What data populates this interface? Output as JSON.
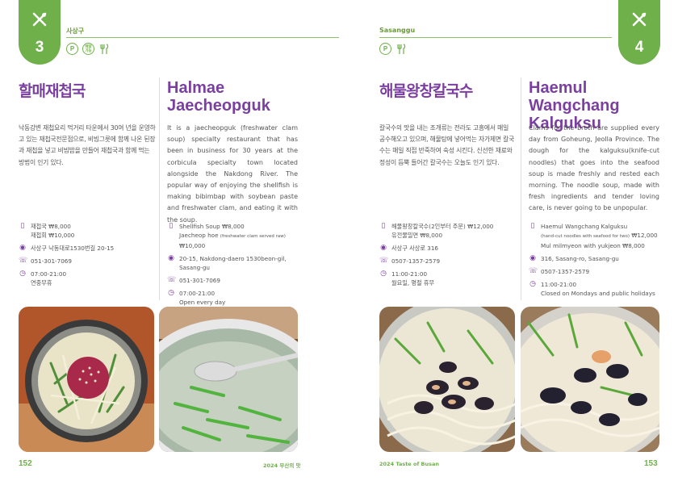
{
  "left_page": {
    "tab_number": "3",
    "district": "사상구",
    "amenity_icons": [
      "parking-icon",
      "delivery-icon",
      "kids-menu-icon"
    ],
    "amenity_icon_labels": [
      "P",
      "배달 가능",
      "키즈"
    ],
    "title_ko": "할매재첩국",
    "title_en_line1": "Halmae",
    "title_en_line2": "Jaecheopguk",
    "desc_ko": "낙동강변 재첩요리 먹거리 타운에서 30여 년을 운영하고 있는 재첩국전문점으로, 비빔그릇에 함께 나온 된장과 재첩을 넣고 비빔밥을 만들어 재첩국과 함께 먹는 방법이 인기 있다.",
    "desc_en": "It is a jaecheopguk (freshwater clam soup) specialty restaurant that has been in business for 30 years at the corbicula specialty town located alongside the Nakdong River. The popular way of enjoying the shellfish is making bibimbap with soybean paste and freshwater clam, and eating it with the soup.",
    "info_ko": {
      "menu": [
        "재첩국 ₩8,000",
        "재첩회 ₩10,000"
      ],
      "address": "사상구 낙동대로1530번길 20-15",
      "phone": "051-301-7069",
      "hours": [
        "07:00-21:00",
        "연중무휴"
      ]
    },
    "info_en": {
      "menu_line1": "Shellfish Soup ₩8,000",
      "menu_line2": "Jaecheop hoe",
      "menu_line2_note": "(freshwater clam served raw)",
      "menu_line3": "₩10,000",
      "address": "20-15, Nakdong-daero 1530beon-gil, Sasang-gu",
      "phone": "051-301-7069",
      "hours": [
        "07:00-21:00",
        "Open every day"
      ]
    },
    "page_number": "152",
    "footer": "2024 부산의 맛"
  },
  "right_page": {
    "tab_number": "4",
    "district": "Sasanggu",
    "amenity_icons": [
      "parking-icon",
      "kids-menu-icon"
    ],
    "amenity_icon_labels": [
      "P",
      "키즈"
    ],
    "title_ko": "해물왕창칼국수",
    "title_en_line1": "Haemul Wangchang",
    "title_en_line2": "Kalguksu",
    "desc_ko": "칼국수의 맛을 내는 조개류는 전라도 고흥에서 매일 공수해오고 있으며, 해물탕에 넣어먹는 자가제면 칼국수는 매일 직접 반죽하여 숙성 시킨다. 신선한 재료와 정성이 듬뿍 들어간 칼국수는 오늘도 인기 있다.",
    "desc_en": "Clams for the broth are supplied every day from Goheung, Jeolla Province. The dough for the kalguksu(knife-cut noodles) that goes into the seafood soup is made freshly and rested each morning. The noodle soup, made with fresh ingredients and tender loving care, is never going to be unpopular.",
    "info_ko": {
      "menu": [
        "해물왕창칼국수(2인부터 주문) ₩12,000",
        "유전물밀면 ₩8,000"
      ],
      "address": "사상구 사상로 316",
      "phone": "0507-1357-2579",
      "hours": [
        "11:00-21:00",
        "월요일, 명절 휴무"
      ]
    },
    "info_en": {
      "menu_line1": "Haemul Wangchang Kalguksu",
      "menu_line2_note": "(hand-cut noodles with seafood for two)",
      "menu_line2_price": "₩12,000",
      "menu_line3": "Mul milmyeon with yukjeon ₩8,000",
      "address": "316, Sasang-ro, Sasang-gu",
      "phone": "0507-1357-2579",
      "hours": [
        "11:00-21:00",
        "Closed on Mondays and public holidays"
      ]
    },
    "page_number": "153",
    "footer": "2024 Taste of Busan"
  },
  "colors": {
    "accent_green": "#6fb04a",
    "title_purple": "#7b3fa0",
    "text_gray": "#555555"
  }
}
